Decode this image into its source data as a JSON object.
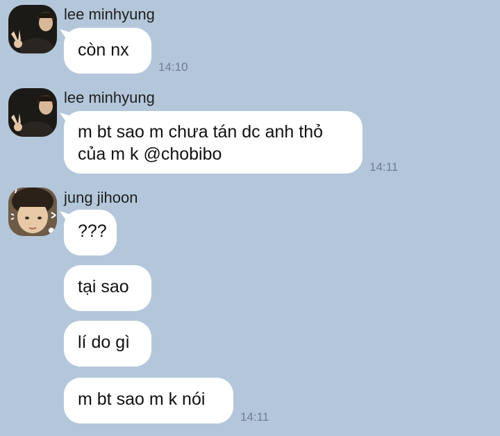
{
  "chat": {
    "groups": [
      {
        "sender": "lee minhyung",
        "avatar": "lee-minhyung-avatar",
        "messages": [
          {
            "text": "còn nx",
            "time": "14:10"
          }
        ]
      },
      {
        "sender": "lee minhyung",
        "avatar": "lee-minhyung-avatar",
        "messages": [
          {
            "text": "m bt sao m chưa tán dc anh thỏ\ncủa m k @chobibo",
            "time": "14:11"
          }
        ]
      },
      {
        "sender": "jung jihoon",
        "avatar": "jung-jihoon-avatar",
        "messages": [
          {
            "text": "???"
          },
          {
            "text": "tại sao"
          },
          {
            "text": "lí do gì"
          },
          {
            "text": "m bt sao m k nói",
            "time": "14:11"
          }
        ]
      }
    ]
  },
  "colors": {
    "background": "#b4c7da",
    "bubble": "#ffffff",
    "timestamp": "#6f7d8b"
  }
}
